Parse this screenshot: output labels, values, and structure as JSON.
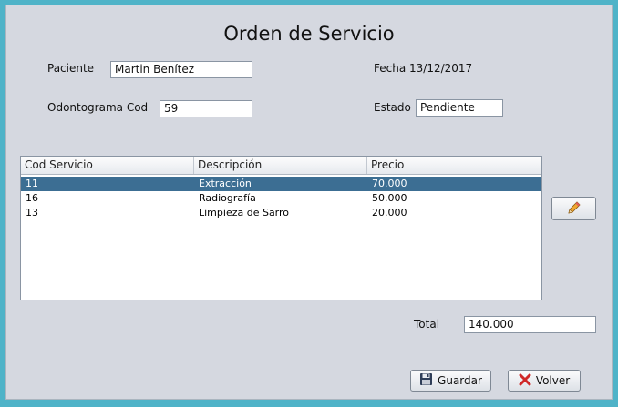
{
  "form": {
    "title": "Orden de Servicio",
    "paciente_label": "Paciente",
    "paciente_value": "Martin Benítez",
    "fecha_text": "Fecha 13/12/2017",
    "odontograma_label": "Odontograma Cod",
    "odontograma_value": "59",
    "estado_label": "Estado",
    "estado_value": "Pendiente",
    "total_label": "Total",
    "total_value": "140.000"
  },
  "table": {
    "columns": [
      "Cod Servicio",
      "Descripción",
      "Precio"
    ],
    "rows": [
      {
        "cod": "11",
        "desc": "Extracción",
        "precio": "70.000",
        "selected": true
      },
      {
        "cod": "16",
        "desc": "Radiografía",
        "precio": "50.000",
        "selected": false
      },
      {
        "cod": "13",
        "desc": "Limpieza de Sarro",
        "precio": "20.000",
        "selected": false
      }
    ]
  },
  "buttons": {
    "edit_icon": "pencil-icon",
    "guardar_label": "Guardar",
    "guardar_icon": "floppy-disk-icon",
    "volver_label": "Volver",
    "volver_icon": "red-x-icon"
  },
  "colors": {
    "selection": "#3c6e93",
    "frame": "#4fb3c8"
  }
}
